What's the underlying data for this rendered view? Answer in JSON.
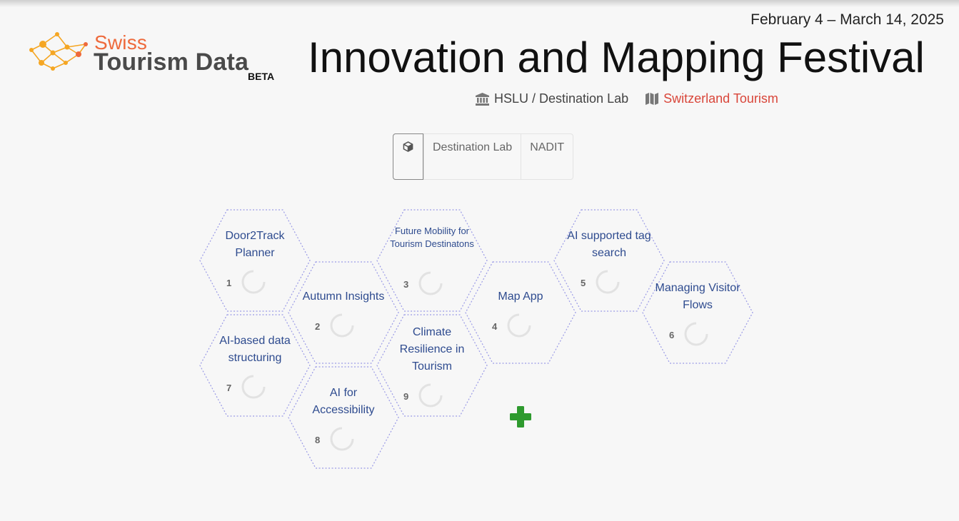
{
  "header": {
    "dates": "February 4 – March 14, 2025",
    "title": "Innovation and Mapping Festival",
    "organizer": "HSLU / Destination Lab",
    "partner": "Switzerland Tourism"
  },
  "logo": {
    "line1": "Swiss",
    "line2": "Tourism Data",
    "badge": "BETA"
  },
  "tabs": {
    "icon": "cube-icon",
    "items": [
      "Destination Lab",
      "NADIT"
    ]
  },
  "projects": [
    {
      "num": "1",
      "title": "Door2Track Planner"
    },
    {
      "num": "2",
      "title": "Autumn Insights"
    },
    {
      "num": "3",
      "title": "Future Mobility for Tourism Destinatons"
    },
    {
      "num": "4",
      "title": "Map App"
    },
    {
      "num": "5",
      "title": "AI supported tag search"
    },
    {
      "num": "6",
      "title": "Managing Visitor Flows"
    },
    {
      "num": "7",
      "title": "AI-based data structuring"
    },
    {
      "num": "8",
      "title": "AI for Accessibility"
    },
    {
      "num": "9",
      "title": "Climate Resilience in Tourism"
    }
  ],
  "icons": {
    "organizer": "institution-icon",
    "partner": "map-icon",
    "add": "plus-icon",
    "progress": "progress-ring-icon"
  },
  "colors": {
    "accent_orange": "#ee6a3c",
    "partner_red": "#d9463a",
    "project_blue": "#2e4b8f",
    "hex_border": "#8f8fe6",
    "add_green": "#2e9a2e"
  }
}
